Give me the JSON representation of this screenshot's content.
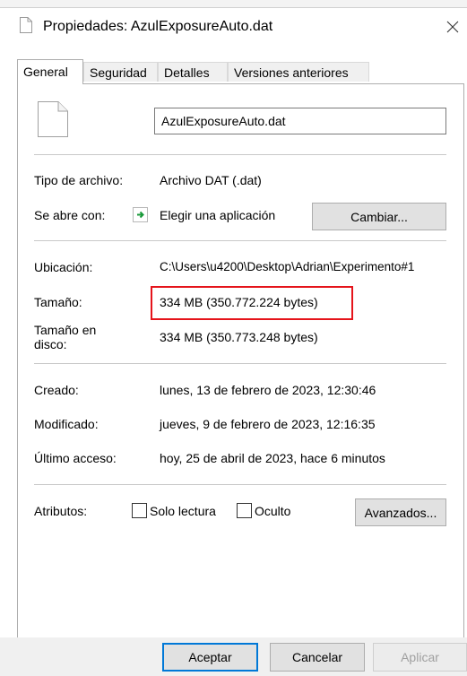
{
  "window": {
    "title": "Propiedades: AzulExposureAuto.dat",
    "close_icon": "close-icon"
  },
  "tabs": [
    {
      "label": "General",
      "active": true
    },
    {
      "label": "Seguridad",
      "active": false
    },
    {
      "label": "Detalles",
      "active": false
    },
    {
      "label": "Versiones anteriores",
      "active": false
    }
  ],
  "file": {
    "icon": "file-icon",
    "name": "AzulExposureAuto.dat"
  },
  "type": {
    "label": "Tipo de archivo:",
    "value": "Archivo DAT (.dat)"
  },
  "opens_with": {
    "label": "Se abre con:",
    "value": "Elegir una aplicación",
    "icon": "app-arrow-icon",
    "change_button": "Cambiar..."
  },
  "location": {
    "label": "Ubicación:",
    "value": "C:\\Users\\u4200\\Desktop\\Adrian\\Experimento#1"
  },
  "size": {
    "label": "Tamaño:",
    "value": "334 MB (350.772.224 bytes)"
  },
  "size_on_disk": {
    "label_line1": "Tamaño en",
    "label_line2": "disco:",
    "value": "334 MB (350.773.248 bytes)"
  },
  "created": {
    "label": "Creado:",
    "value": "lunes, 13 de febrero de 2023, 12:30:46"
  },
  "modified": {
    "label": "Modificado:",
    "value": "jueves, 9 de febrero de 2023, 12:16:35"
  },
  "accessed": {
    "label": "Último acceso:",
    "value": "hoy, 25 de abril de 2023, hace 6 minutos"
  },
  "attributes": {
    "label": "Atributos:",
    "read_only_label": "Solo lectura",
    "read_only_checked": false,
    "hidden_label": "Oculto",
    "hidden_checked": false,
    "advanced_button": "Avanzados..."
  },
  "footer": {
    "ok": "Aceptar",
    "cancel": "Cancelar",
    "apply": "Aplicar"
  },
  "colors": {
    "highlight": "#e5141b",
    "focus_border": "#0078d7"
  }
}
